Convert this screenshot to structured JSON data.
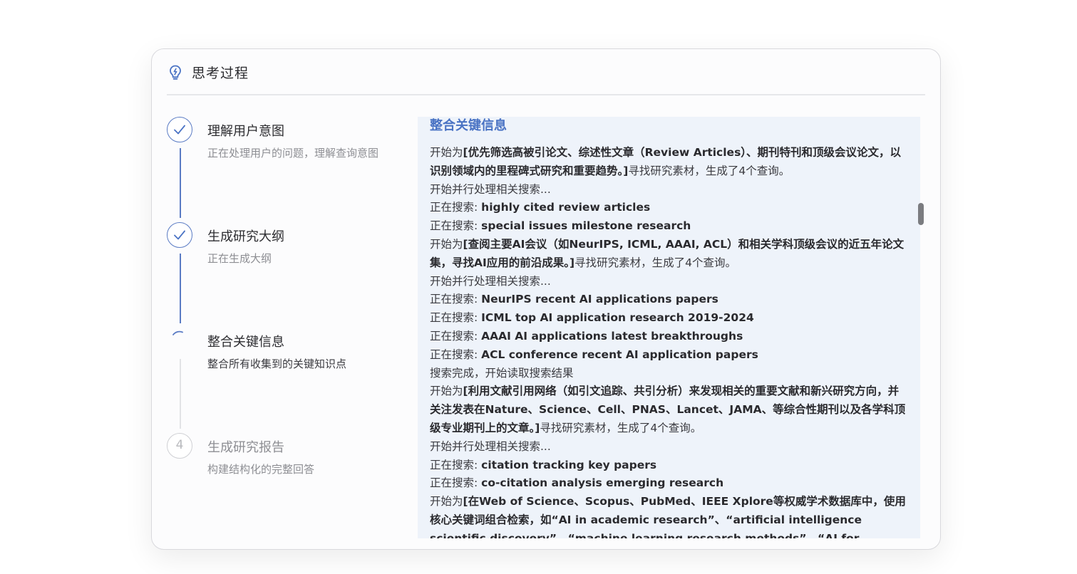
{
  "panel": {
    "title": "思考过程",
    "icon": "lightbulb-icon",
    "accent_color": "#4a73c4"
  },
  "steps": [
    {
      "title": "理解用户意图",
      "description": "正在处理用户的问题，理解查询意图",
      "status": "done"
    },
    {
      "title": "生成研究大纲",
      "description": "正在生成大纲",
      "status": "done"
    },
    {
      "title": "整合关键信息",
      "description": "整合所有收集到的关键知识点",
      "status": "active"
    },
    {
      "number": "4",
      "title": "生成研究报告",
      "description": "构建结构化的完整回答",
      "status": "pending"
    }
  ],
  "log": {
    "heading": "整合关键信息",
    "entries": [
      {
        "prefix": "开始为",
        "bold": "[优先筛选高被引论文、综述性文章（Review Articles）、期刊特刊和顶级会议论文，以识别领域内的里程碑式研究和重要趋势。]",
        "suffix": "寻找研究素材，生成了4个查询。"
      },
      {
        "prefix": "开始并行处理相关搜索...",
        "bold": "",
        "suffix": ""
      },
      {
        "prefix": "正在搜索: ",
        "bold": "highly cited review articles",
        "suffix": ""
      },
      {
        "prefix": "正在搜索: ",
        "bold": "special issues milestone research",
        "suffix": ""
      },
      {
        "prefix": "开始为",
        "bold": "[查阅主要AI会议（如NeurIPS, ICML, AAAI, ACL）和相关学科顶级会议的近五年论文集，寻找AI应用的前沿成果。]",
        "suffix": "寻找研究素材，生成了4个查询。"
      },
      {
        "prefix": "开始并行处理相关搜索...",
        "bold": "",
        "suffix": ""
      },
      {
        "prefix": "正在搜索: ",
        "bold": "NeurIPS recent AI applications papers",
        "suffix": ""
      },
      {
        "prefix": "正在搜索: ",
        "bold": "ICML top AI application research 2019-2024",
        "suffix": ""
      },
      {
        "prefix": "正在搜索: ",
        "bold": "AAAI AI applications latest breakthroughs",
        "suffix": ""
      },
      {
        "prefix": "正在搜索: ",
        "bold": "ACL conference recent AI application papers",
        "suffix": ""
      },
      {
        "prefix": "搜索完成，开始读取搜索结果",
        "bold": "",
        "suffix": ""
      },
      {
        "prefix": "开始为",
        "bold": "[利用文献引用网络（如引文追踪、共引分析）来发现相关的重要文献和新兴研究方向，并关注发表在Nature、Science、Cell、PNAS、Lancet、JAMA、等综合性期刊以及各学科顶级专业期刊上的文章。]",
        "suffix": "寻找研究素材，生成了4个查询。"
      },
      {
        "prefix": "开始并行处理相关搜索...",
        "bold": "",
        "suffix": ""
      },
      {
        "prefix": "正在搜索: ",
        "bold": "citation tracking key papers",
        "suffix": ""
      },
      {
        "prefix": "正在搜索: ",
        "bold": "co-citation analysis emerging research",
        "suffix": ""
      },
      {
        "prefix": "开始为",
        "bold": "[在Web of Science、Scopus、PubMed、IEEE Xplore等权威学术数据库中，使用核心关键词组合检索，如“AI in academic research”、“artificial intelligence scientific discovery”、“machine learning research methods”、“AI for literature review”、“AI",
        "suffix": ""
      }
    ]
  }
}
